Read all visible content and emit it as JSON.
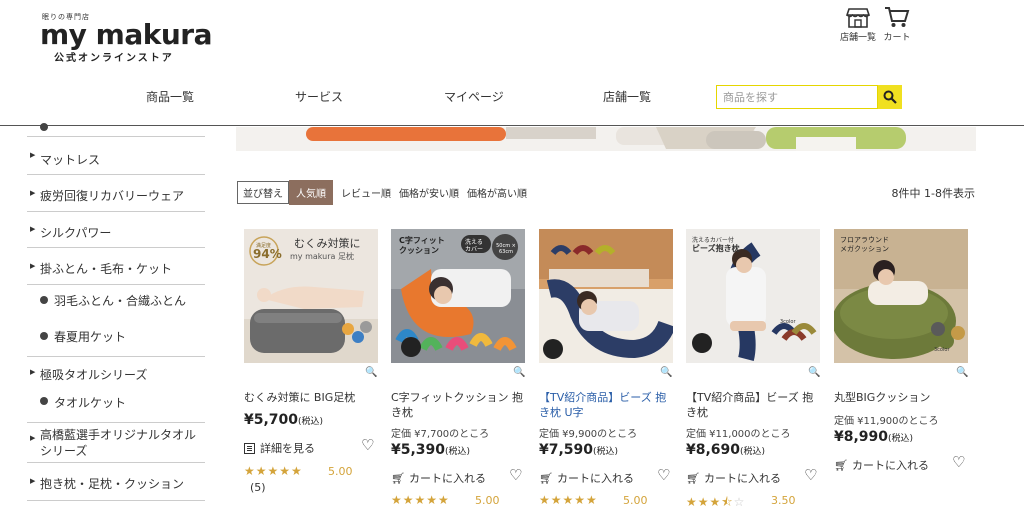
{
  "header": {
    "logo_tagline": "眠りの専門店",
    "logo_main": "my makura",
    "logo_sub": "公式オンラインストア",
    "store_list_label": "店舗一覧",
    "cart_label": "カート"
  },
  "nav": {
    "items": [
      "商品一覧",
      "サービス",
      "マイページ",
      "店舗一覧"
    ]
  },
  "search": {
    "placeholder": "商品を探す",
    "value": ""
  },
  "sidebar": {
    "items": [
      {
        "label": "マットレス",
        "level": 1
      },
      {
        "label": "疲労回復リカバリーウェア",
        "level": 1
      },
      {
        "label": "シルクパワー",
        "level": 1
      },
      {
        "label": "掛ふとん・毛布・ケット",
        "level": 1
      },
      {
        "label": "羽毛ふとん・合繊ふとん",
        "level": 2
      },
      {
        "label": "春夏用ケット",
        "level": 2
      },
      {
        "label": "極吸タオルシリーズ",
        "level": 1
      },
      {
        "label": "タオルケット",
        "level": 2
      },
      {
        "label": "高橋藍選手オリジナルタオルシリーズ",
        "level": 1
      },
      {
        "label": "抱き枕・足枕・クッション",
        "level": 1
      }
    ]
  },
  "sort": {
    "label": "並び替え",
    "active": "人気順",
    "options": [
      "レビュー順",
      "価格が安い順",
      "価格が高い順"
    ]
  },
  "result_count": "8件中 1-8件表示",
  "products": [
    {
      "title": "むくみ対策に BIG足枕",
      "original_price": "",
      "price": "¥5,700",
      "tax": "(税込)",
      "action": "詳細を見る",
      "rating": 5.0,
      "rating_text": "5.00",
      "review_count": "(5)",
      "image_text": [
        "むくみ対策に",
        "my makura 足枕",
        "満足度",
        "94%"
      ]
    },
    {
      "title": "C字フィットクッション 抱き枕",
      "original_price": "定価 ¥7,700のところ",
      "price": "¥5,390",
      "tax": "(税込)",
      "action": "カートに入れる",
      "rating": 5.0,
      "rating_text": "5.00",
      "review_count": "",
      "image_text": [
        "C字フィット",
        "クッション",
        "洗える",
        "カバー",
        "50cm × 63cm"
      ]
    },
    {
      "title": "【TV紹介商品】ビーズ 抱き枕 U字",
      "original_price": "定価 ¥9,900のところ",
      "price": "¥7,590",
      "tax": "(税込)",
      "action": "カートに入れる",
      "rating": 5.0,
      "rating_text": "5.00",
      "review_count": "",
      "image_text": []
    },
    {
      "title": "【TV紹介商品】ビーズ 抱き枕",
      "original_price": "定価 ¥11,000のところ",
      "price": "¥8,690",
      "tax": "(税込)",
      "action": "カートに入れる",
      "rating": 3.5,
      "rating_text": "3.50",
      "review_count": "",
      "image_text": [
        "洗えるカバー付",
        "ビーズ抱き枕",
        "3color"
      ]
    },
    {
      "title": "丸型BIGクッション",
      "original_price": "定価 ¥11,900のところ",
      "price": "¥8,990",
      "tax": "(税込)",
      "action": "カートに入れる",
      "rating": null,
      "rating_text": "",
      "review_count": "",
      "image_text": [
        "フロアラウンド",
        "メガクッション",
        "3color"
      ]
    }
  ],
  "colors": {
    "accent_brown": "#8c6e5e",
    "search_yellow": "#f0e020",
    "star_gold": "#d4a43b",
    "title_blue": "#2a5ea8"
  }
}
